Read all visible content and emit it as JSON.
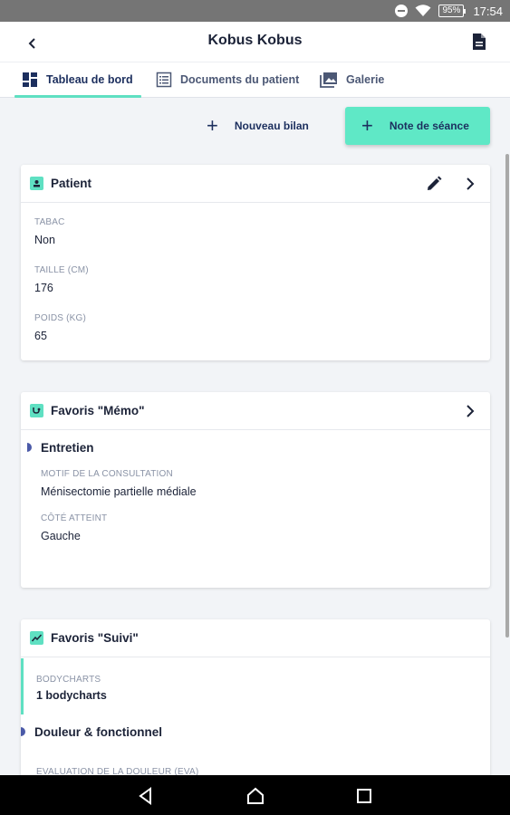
{
  "status_bar": {
    "battery": "95%",
    "time": "17:54"
  },
  "app_bar": {
    "title": "Kobus Kobus"
  },
  "tabs": [
    {
      "label": "Tableau de bord",
      "icon": "dashboard-icon",
      "active": true
    },
    {
      "label": "Documents du patient",
      "icon": "document-list-icon",
      "active": false
    },
    {
      "label": "Galerie",
      "icon": "gallery-icon",
      "active": false
    }
  ],
  "actions": {
    "new_assessment": "Nouveau bilan",
    "session_note": "Note de séance"
  },
  "colors": {
    "accent": "#5fe8c6",
    "primary_text": "#1c2f5e",
    "marker": "#4b5aa8"
  },
  "patient_card": {
    "title": "Patient",
    "fields": [
      {
        "label": "TABAC",
        "value": "Non"
      },
      {
        "label": "TAILLE (CM)",
        "value": "176"
      },
      {
        "label": "POIDS (KG)",
        "value": "65"
      }
    ]
  },
  "memo_card": {
    "title": "Favoris \"Mémo\"",
    "section": "Entretien",
    "fields": [
      {
        "label": "MOTIF DE LA CONSULTATION",
        "value": "Ménisectomie partielle médiale"
      },
      {
        "label": "CÔTÉ ATTEINT",
        "value": "Gauche"
      }
    ]
  },
  "suivi_card": {
    "title": "Favoris \"Suivi\"",
    "bodycharts": {
      "label": "BODYCHARTS",
      "value": "1 bodycharts"
    },
    "section": "Douleur & fonctionnel",
    "partial_label": "EVALUATION DE LA DOULEUR (EVA)"
  }
}
